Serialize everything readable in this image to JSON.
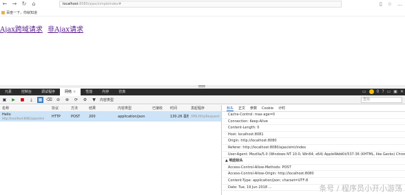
{
  "browser": {
    "back": "←",
    "forward": "→",
    "refresh": "↻",
    "home": "⌂",
    "address_host": "localhost",
    "address_path": ":8080/ajax/simpleIndex#",
    "reader": "▯",
    "favorite": "☆",
    "more": "…"
  },
  "favorites": {
    "item1": "百度一下，你就知道"
  },
  "page": {
    "link1": "Ajax跨域请求",
    "link2": "非Ajax请求"
  },
  "devtools": {
    "tabs": [
      "元素",
      "控制台",
      "调试程序",
      "网络",
      "性能",
      "内存",
      "仿真"
    ],
    "active_tab_index": 3,
    "close_glyph": "×",
    "right_icons": [
      "▭",
      "☺",
      "0",
      "?",
      "▭",
      "▣",
      "✕"
    ],
    "toolbar": {
      "content_type_label": "内容类型",
      "find_placeholder": "查找"
    },
    "net_headers": [
      "名称",
      "协议",
      "方法",
      "结果",
      "内容类型",
      "已接收",
      "时间",
      "发起程序"
    ],
    "net_rows": [
      {
        "name": "Hello",
        "url": "http://localhost:8081/ajax/simi",
        "protocol": "HTTP",
        "method": "POST",
        "result": "200",
        "content_type": "application/json",
        "received": "",
        "time": "130.26 毫秒",
        "initiator": "XMLHttpRequest"
      }
    ],
    "detail_tabs": [
      "标头",
      "正文",
      "参数",
      "Cookie",
      "计时"
    ],
    "detail_active_index": 0,
    "headers": [
      "Cache-Control: max-age=0",
      "Connection: Keep-Alive",
      "Content-Length: 0",
      "Host: localhost:8081",
      "Origin: http://localhost:8080",
      "Referer: http://localhost:8080/ajax/simi/index",
      "User-Agent: Mozilla/5.0 (Windows NT 10.0; Win64; x64) AppleWebKit/537.36 (KHTML, like Gecko) Chrome/..."
    ],
    "response_section": "▲ 响应标头",
    "response_headers": [
      "Access-Control-Allow-Methods: POST",
      "Access-Control-Allow-Origin: http://localhost:8080",
      "Content-Type: application/json; charset=UTF-8",
      "Date: Tue, 19 Jun 2018 ..."
    ]
  },
  "watermark": "条号 / 程序员小开小游荡"
}
